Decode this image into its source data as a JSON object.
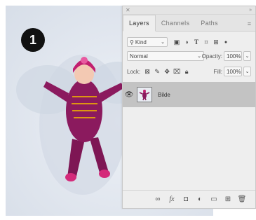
{
  "badge": {
    "label": "1"
  },
  "panel": {
    "tabs": [
      {
        "label": "Layers"
      },
      {
        "label": "Channels"
      },
      {
        "label": "Paths"
      }
    ],
    "filter": {
      "kind_label": "Kind"
    },
    "blend_mode": "Normal",
    "opacity_label": "Opacity:",
    "opacity_value": "100%",
    "lock_label": "Lock:",
    "fill_label": "Fill:",
    "fill_value": "100%",
    "layers": [
      {
        "name": "Bilde"
      }
    ]
  },
  "icons": {
    "close": "close-icon",
    "collapse": "collapse-icon",
    "panel_menu": "menu-icon",
    "search": "search-icon",
    "eye": "eye-icon"
  },
  "colors": {
    "panel_bg": "#eeeeee",
    "selected_layer": "#c3c3c3",
    "badge_bg": "#111111",
    "snowsuit": "#8b1a5e"
  }
}
